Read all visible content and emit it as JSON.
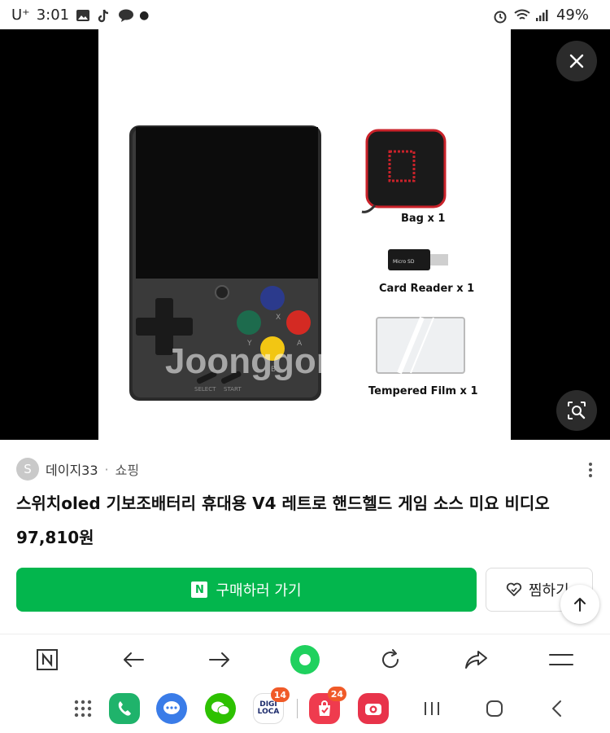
{
  "status_bar": {
    "carrier": "U⁺",
    "time": "3:01",
    "battery": "49%"
  },
  "viewer": {
    "watermark": "Joonggonara",
    "accessories": [
      {
        "label": "Bag x 1"
      },
      {
        "label": "Card Reader x 1"
      },
      {
        "label": "Tempered Film x 1"
      }
    ],
    "button_labels": [
      "X",
      "Y",
      "A",
      "B"
    ],
    "select_label": "SELECT",
    "start_label": "START",
    "card_reader_text": "Micro SD"
  },
  "seller": {
    "avatar_letter": "S",
    "name": "데이지33",
    "separator": "·",
    "category": "쇼핑"
  },
  "product": {
    "title": "스위치oled 기보조배터리 휴대용 V4 레트로 핸드헬드 게임 소스 미요 비디오",
    "price": "97,810원"
  },
  "actions": {
    "buy_label": "구매하러 가기",
    "n_badge": "N",
    "wish_label": "찜하기"
  },
  "dock": {
    "apps": [
      {
        "name": "phone",
        "color": "#1fb36b"
      },
      {
        "name": "messages",
        "color": "#3a7ce8"
      },
      {
        "name": "wechat",
        "color": "#2dc100"
      },
      {
        "name": "digiloca",
        "text_top": "DIGI",
        "text_bottom": "LOCA",
        "badge": "14"
      },
      {
        "name": "shopping",
        "color": "#ef3b4e",
        "badge": "24"
      },
      {
        "name": "camera",
        "color": "#e8334a"
      }
    ]
  }
}
